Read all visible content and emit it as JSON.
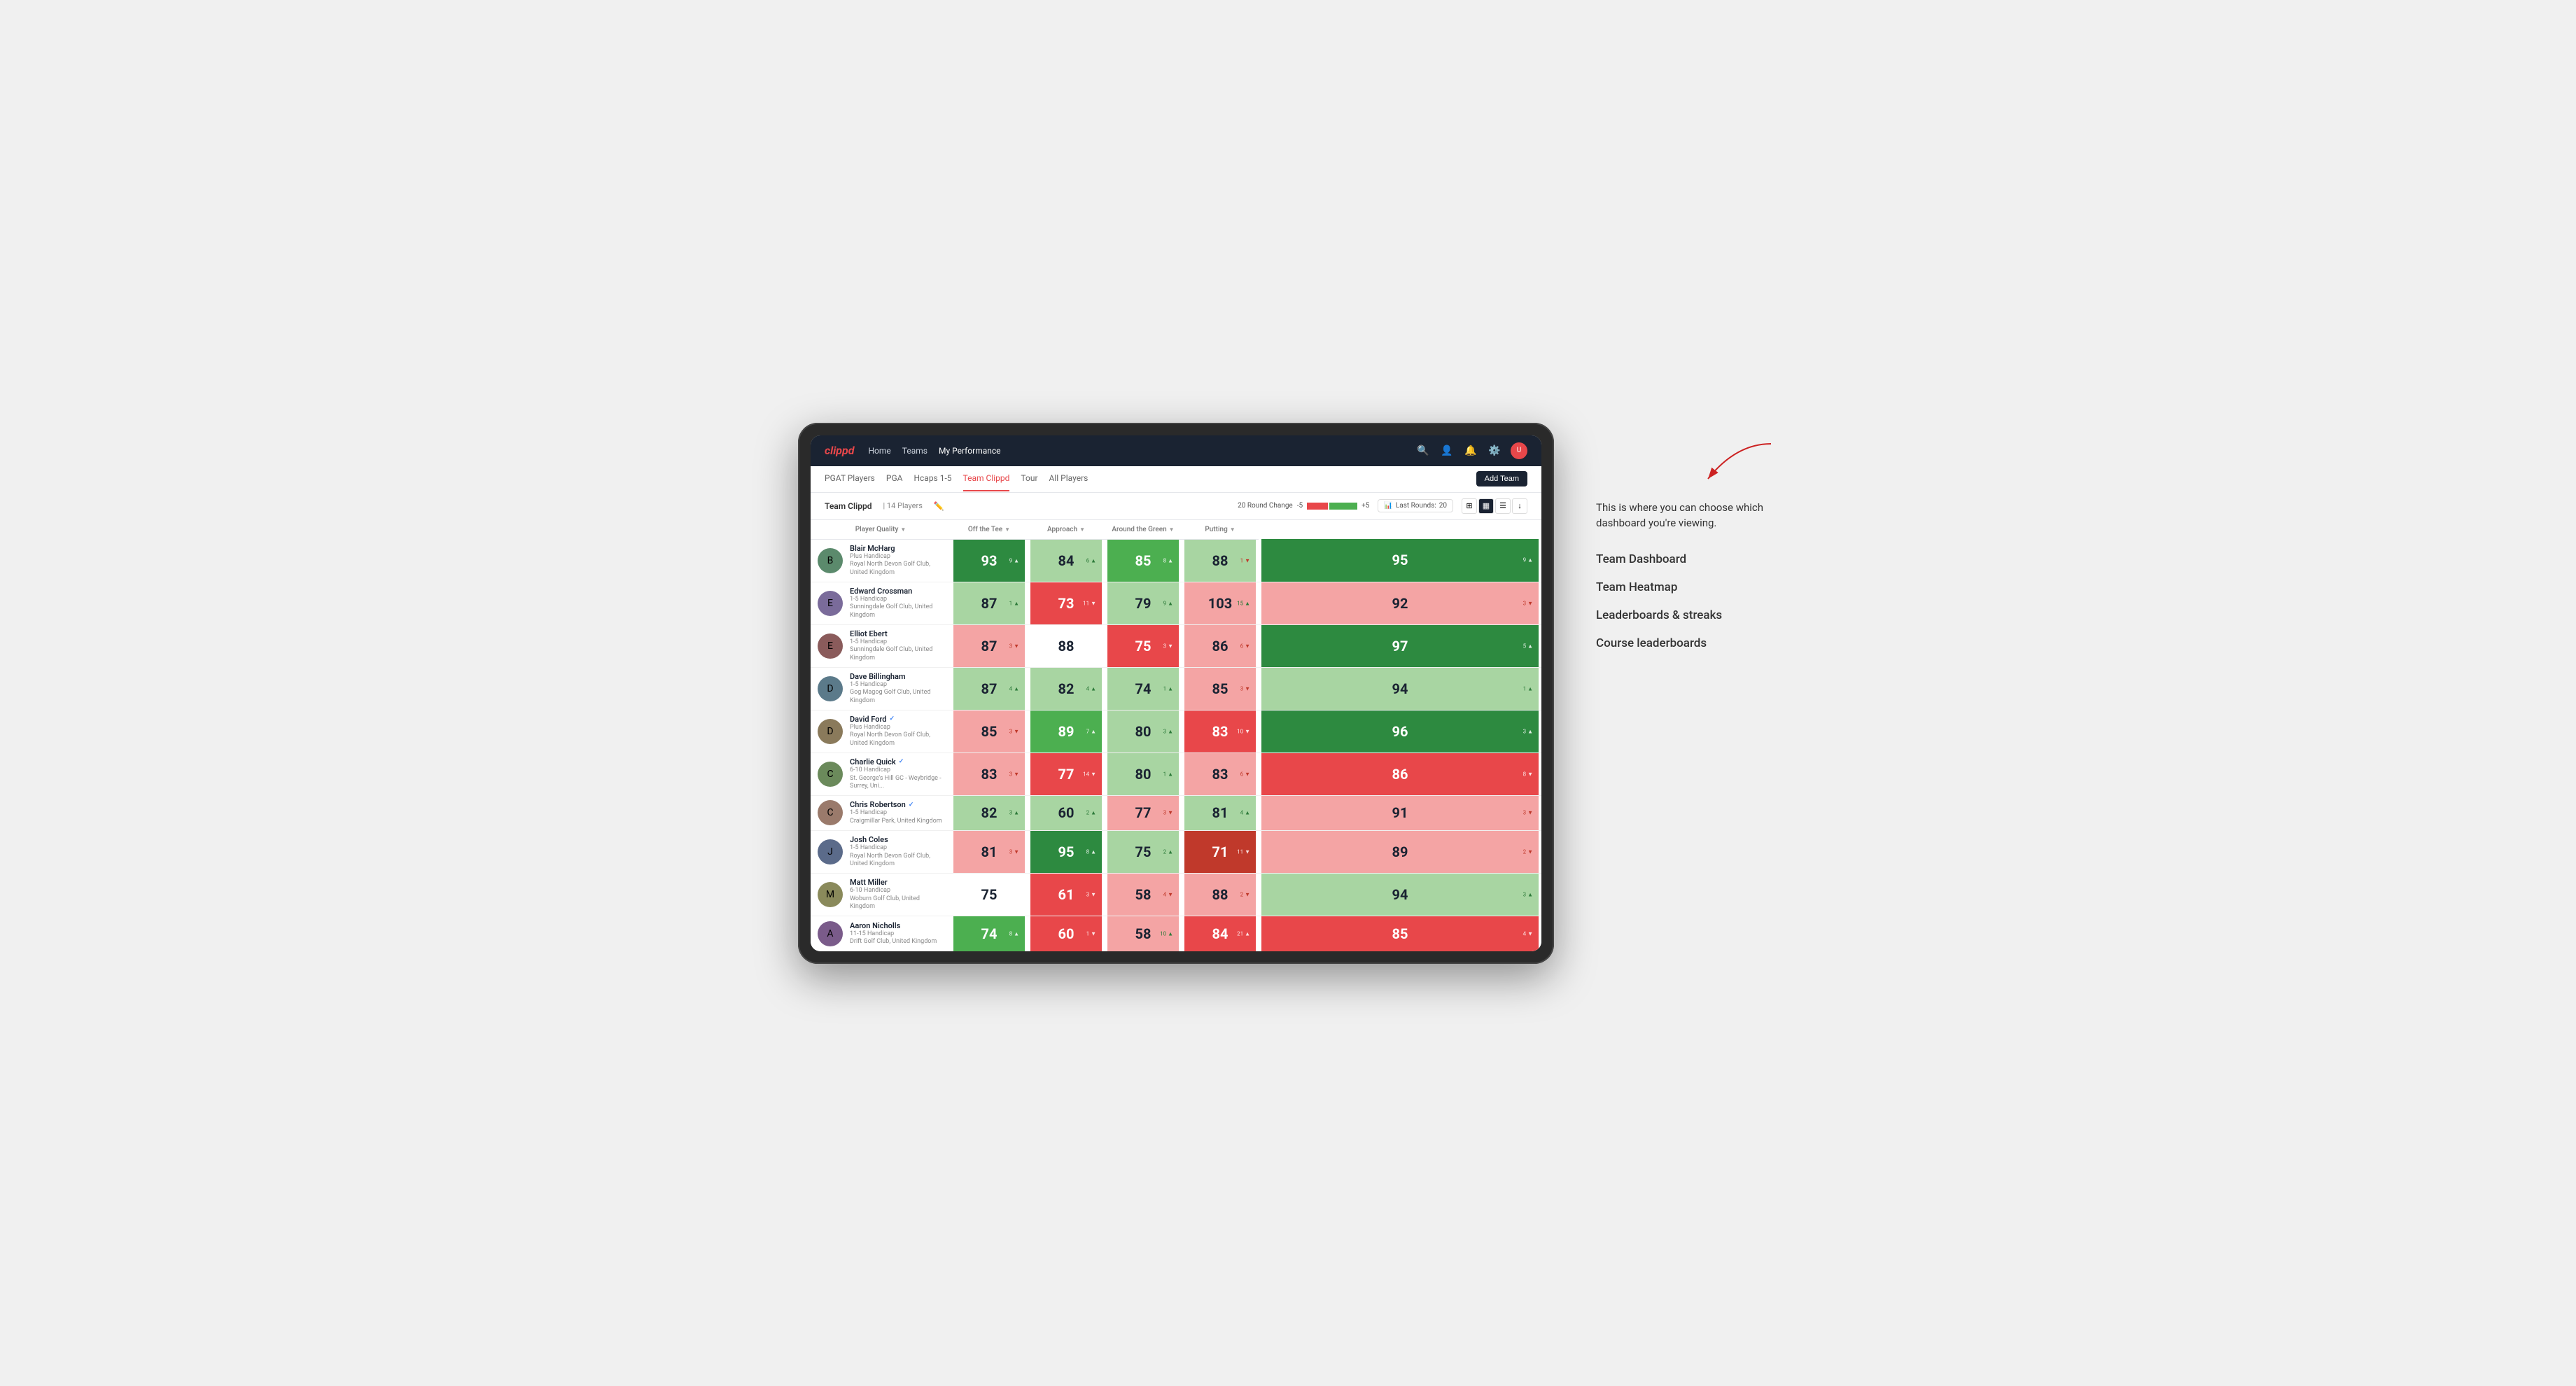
{
  "annotation": {
    "intro_text": "This is where you can choose which dashboard you're viewing.",
    "items": [
      {
        "label": "Team Dashboard"
      },
      {
        "label": "Team Heatmap"
      },
      {
        "label": "Leaderboards & streaks"
      },
      {
        "label": "Course leaderboards"
      }
    ]
  },
  "nav": {
    "logo": "clippd",
    "items": [
      {
        "label": "Home",
        "active": false
      },
      {
        "label": "Teams",
        "active": false
      },
      {
        "label": "My Performance",
        "active": true
      }
    ]
  },
  "sub_nav": {
    "items": [
      {
        "label": "PGAT Players",
        "active": false
      },
      {
        "label": "PGA",
        "active": false
      },
      {
        "label": "Hcaps 1-5",
        "active": false
      },
      {
        "label": "Team Clippd",
        "active": true
      },
      {
        "label": "Tour",
        "active": false
      },
      {
        "label": "All Players",
        "active": false
      }
    ],
    "add_team_label": "Add Team"
  },
  "team_header": {
    "title": "Team Clippd",
    "separator": "|",
    "count": "14 Players",
    "round_change_label": "20 Round Change",
    "change_neg": "-5",
    "change_pos": "+5",
    "last_rounds_label": "Last Rounds:",
    "last_rounds_value": "20"
  },
  "table": {
    "columns": [
      {
        "label": "Player Quality",
        "sortable": true
      },
      {
        "label": "Off the Tee",
        "sortable": true
      },
      {
        "label": "Approach",
        "sortable": true
      },
      {
        "label": "Around the Green",
        "sortable": true
      },
      {
        "label": "Putting",
        "sortable": true
      }
    ],
    "rows": [
      {
        "name": "Blair McHarg",
        "handicap": "Plus Handicap",
        "club": "Royal North Devon Golf Club, United Kingdom",
        "avatar_emoji": "🧑",
        "scores": [
          {
            "value": 93,
            "change": 9,
            "dir": "up",
            "bg": "bg-green-strong",
            "text": "text-white"
          },
          {
            "value": 84,
            "change": 6,
            "dir": "up",
            "bg": "bg-green-light",
            "text": ""
          },
          {
            "value": 85,
            "change": 8,
            "dir": "up",
            "bg": "bg-green-medium",
            "text": "text-white"
          },
          {
            "value": 88,
            "change": 1,
            "dir": "down",
            "bg": "bg-green-light",
            "text": ""
          },
          {
            "value": 95,
            "change": 9,
            "dir": "up",
            "bg": "bg-green-strong",
            "text": "text-white"
          }
        ]
      },
      {
        "name": "Edward Crossman",
        "handicap": "1-5 Handicap",
        "club": "Sunningdale Golf Club, United Kingdom",
        "avatar_emoji": "👤",
        "scores": [
          {
            "value": 87,
            "change": 1,
            "dir": "up",
            "bg": "bg-green-light",
            "text": ""
          },
          {
            "value": 73,
            "change": 11,
            "dir": "down",
            "bg": "bg-red-medium",
            "text": "text-white"
          },
          {
            "value": 79,
            "change": 9,
            "dir": "up",
            "bg": "bg-green-light",
            "text": ""
          },
          {
            "value": 103,
            "change": 15,
            "dir": "up",
            "bg": "bg-red-light",
            "text": ""
          },
          {
            "value": 92,
            "change": 3,
            "dir": "down",
            "bg": "bg-red-light",
            "text": ""
          }
        ]
      },
      {
        "name": "Elliot Ebert",
        "handicap": "1-5 Handicap",
        "club": "Sunningdale Golf Club, United Kingdom",
        "avatar_emoji": "👤",
        "scores": [
          {
            "value": 87,
            "change": 3,
            "dir": "down",
            "bg": "bg-red-light",
            "text": ""
          },
          {
            "value": 88,
            "change": null,
            "dir": "neutral",
            "bg": "bg-white",
            "text": ""
          },
          {
            "value": 75,
            "change": 3,
            "dir": "down",
            "bg": "bg-red-medium",
            "text": "text-white"
          },
          {
            "value": 86,
            "change": 6,
            "dir": "down",
            "bg": "bg-red-light",
            "text": ""
          },
          {
            "value": 97,
            "change": 5,
            "dir": "up",
            "bg": "bg-green-strong",
            "text": "text-white"
          }
        ]
      },
      {
        "name": "Dave Billingham",
        "handicap": "1-5 Handicap",
        "club": "Gog Magog Golf Club, United Kingdom",
        "avatar_emoji": "👤",
        "scores": [
          {
            "value": 87,
            "change": 4,
            "dir": "up",
            "bg": "bg-green-light",
            "text": ""
          },
          {
            "value": 82,
            "change": 4,
            "dir": "up",
            "bg": "bg-green-light",
            "text": ""
          },
          {
            "value": 74,
            "change": 1,
            "dir": "up",
            "bg": "bg-green-light",
            "text": ""
          },
          {
            "value": 85,
            "change": 3,
            "dir": "down",
            "bg": "bg-red-light",
            "text": ""
          },
          {
            "value": 94,
            "change": 1,
            "dir": "up",
            "bg": "bg-green-light",
            "text": ""
          }
        ]
      },
      {
        "name": "David Ford",
        "handicap": "Plus Handicap",
        "club": "Royal North Devon Golf Club, United Kingdom",
        "avatar_emoji": "👤",
        "verified": true,
        "scores": [
          {
            "value": 85,
            "change": 3,
            "dir": "down",
            "bg": "bg-red-light",
            "text": ""
          },
          {
            "value": 89,
            "change": 7,
            "dir": "up",
            "bg": "bg-green-medium",
            "text": "text-white"
          },
          {
            "value": 80,
            "change": 3,
            "dir": "up",
            "bg": "bg-green-light",
            "text": ""
          },
          {
            "value": 83,
            "change": 10,
            "dir": "down",
            "bg": "bg-red-medium",
            "text": "text-white"
          },
          {
            "value": 96,
            "change": 3,
            "dir": "up",
            "bg": "bg-green-strong",
            "text": "text-white"
          }
        ]
      },
      {
        "name": "Charlie Quick",
        "handicap": "6-10 Handicap",
        "club": "St. George's Hill GC - Weybridge - Surrey, Uni...",
        "avatar_emoji": "👤",
        "verified": true,
        "scores": [
          {
            "value": 83,
            "change": 3,
            "dir": "down",
            "bg": "bg-red-light",
            "text": ""
          },
          {
            "value": 77,
            "change": 14,
            "dir": "down",
            "bg": "bg-red-medium",
            "text": "text-white"
          },
          {
            "value": 80,
            "change": 1,
            "dir": "up",
            "bg": "bg-green-light",
            "text": ""
          },
          {
            "value": 83,
            "change": 6,
            "dir": "down",
            "bg": "bg-red-light",
            "text": ""
          },
          {
            "value": 86,
            "change": 8,
            "dir": "down",
            "bg": "bg-red-medium",
            "text": "text-white"
          }
        ]
      },
      {
        "name": "Chris Robertson",
        "handicap": "1-5 Handicap",
        "club": "Craigmillar Park, United Kingdom",
        "avatar_emoji": "👤",
        "verified": true,
        "scores": [
          {
            "value": 82,
            "change": 3,
            "dir": "up",
            "bg": "bg-green-light",
            "text": ""
          },
          {
            "value": 60,
            "change": 2,
            "dir": "up",
            "bg": "bg-green-light",
            "text": ""
          },
          {
            "value": 77,
            "change": 3,
            "dir": "down",
            "bg": "bg-red-light",
            "text": ""
          },
          {
            "value": 81,
            "change": 4,
            "dir": "up",
            "bg": "bg-green-light",
            "text": ""
          },
          {
            "value": 91,
            "change": 3,
            "dir": "down",
            "bg": "bg-red-light",
            "text": ""
          }
        ]
      },
      {
        "name": "Josh Coles",
        "handicap": "1-5 Handicap",
        "club": "Royal North Devon Golf Club, United Kingdom",
        "avatar_emoji": "👤",
        "scores": [
          {
            "value": 81,
            "change": 3,
            "dir": "down",
            "bg": "bg-red-light",
            "text": ""
          },
          {
            "value": 95,
            "change": 8,
            "dir": "up",
            "bg": "bg-green-strong",
            "text": "text-white"
          },
          {
            "value": 75,
            "change": 2,
            "dir": "up",
            "bg": "bg-green-light",
            "text": ""
          },
          {
            "value": 71,
            "change": 11,
            "dir": "down",
            "bg": "bg-red-strong",
            "text": "text-white"
          },
          {
            "value": 89,
            "change": 2,
            "dir": "down",
            "bg": "bg-red-light",
            "text": ""
          }
        ]
      },
      {
        "name": "Matt Miller",
        "handicap": "6-10 Handicap",
        "club": "Woburn Golf Club, United Kingdom",
        "avatar_emoji": "👤",
        "scores": [
          {
            "value": 75,
            "change": null,
            "dir": "neutral",
            "bg": "bg-white",
            "text": ""
          },
          {
            "value": 61,
            "change": 3,
            "dir": "down",
            "bg": "bg-red-medium",
            "text": "text-white"
          },
          {
            "value": 58,
            "change": 4,
            "dir": "down",
            "bg": "bg-red-light",
            "text": ""
          },
          {
            "value": 88,
            "change": 2,
            "dir": "down",
            "bg": "bg-red-light",
            "text": ""
          },
          {
            "value": 94,
            "change": 3,
            "dir": "up",
            "bg": "bg-green-light",
            "text": ""
          }
        ]
      },
      {
        "name": "Aaron Nicholls",
        "handicap": "11-15 Handicap",
        "club": "Drift Golf Club, United Kingdom",
        "avatar_emoji": "👤",
        "scores": [
          {
            "value": 74,
            "change": 8,
            "dir": "up",
            "bg": "bg-green-medium",
            "text": "text-white"
          },
          {
            "value": 60,
            "change": 1,
            "dir": "down",
            "bg": "bg-red-medium",
            "text": "text-white"
          },
          {
            "value": 58,
            "change": 10,
            "dir": "up",
            "bg": "bg-red-light",
            "text": ""
          },
          {
            "value": 84,
            "change": 21,
            "dir": "up",
            "bg": "bg-red-medium",
            "text": "text-white"
          },
          {
            "value": 85,
            "change": 4,
            "dir": "down",
            "bg": "bg-red-medium",
            "text": "text-white"
          }
        ]
      }
    ]
  }
}
